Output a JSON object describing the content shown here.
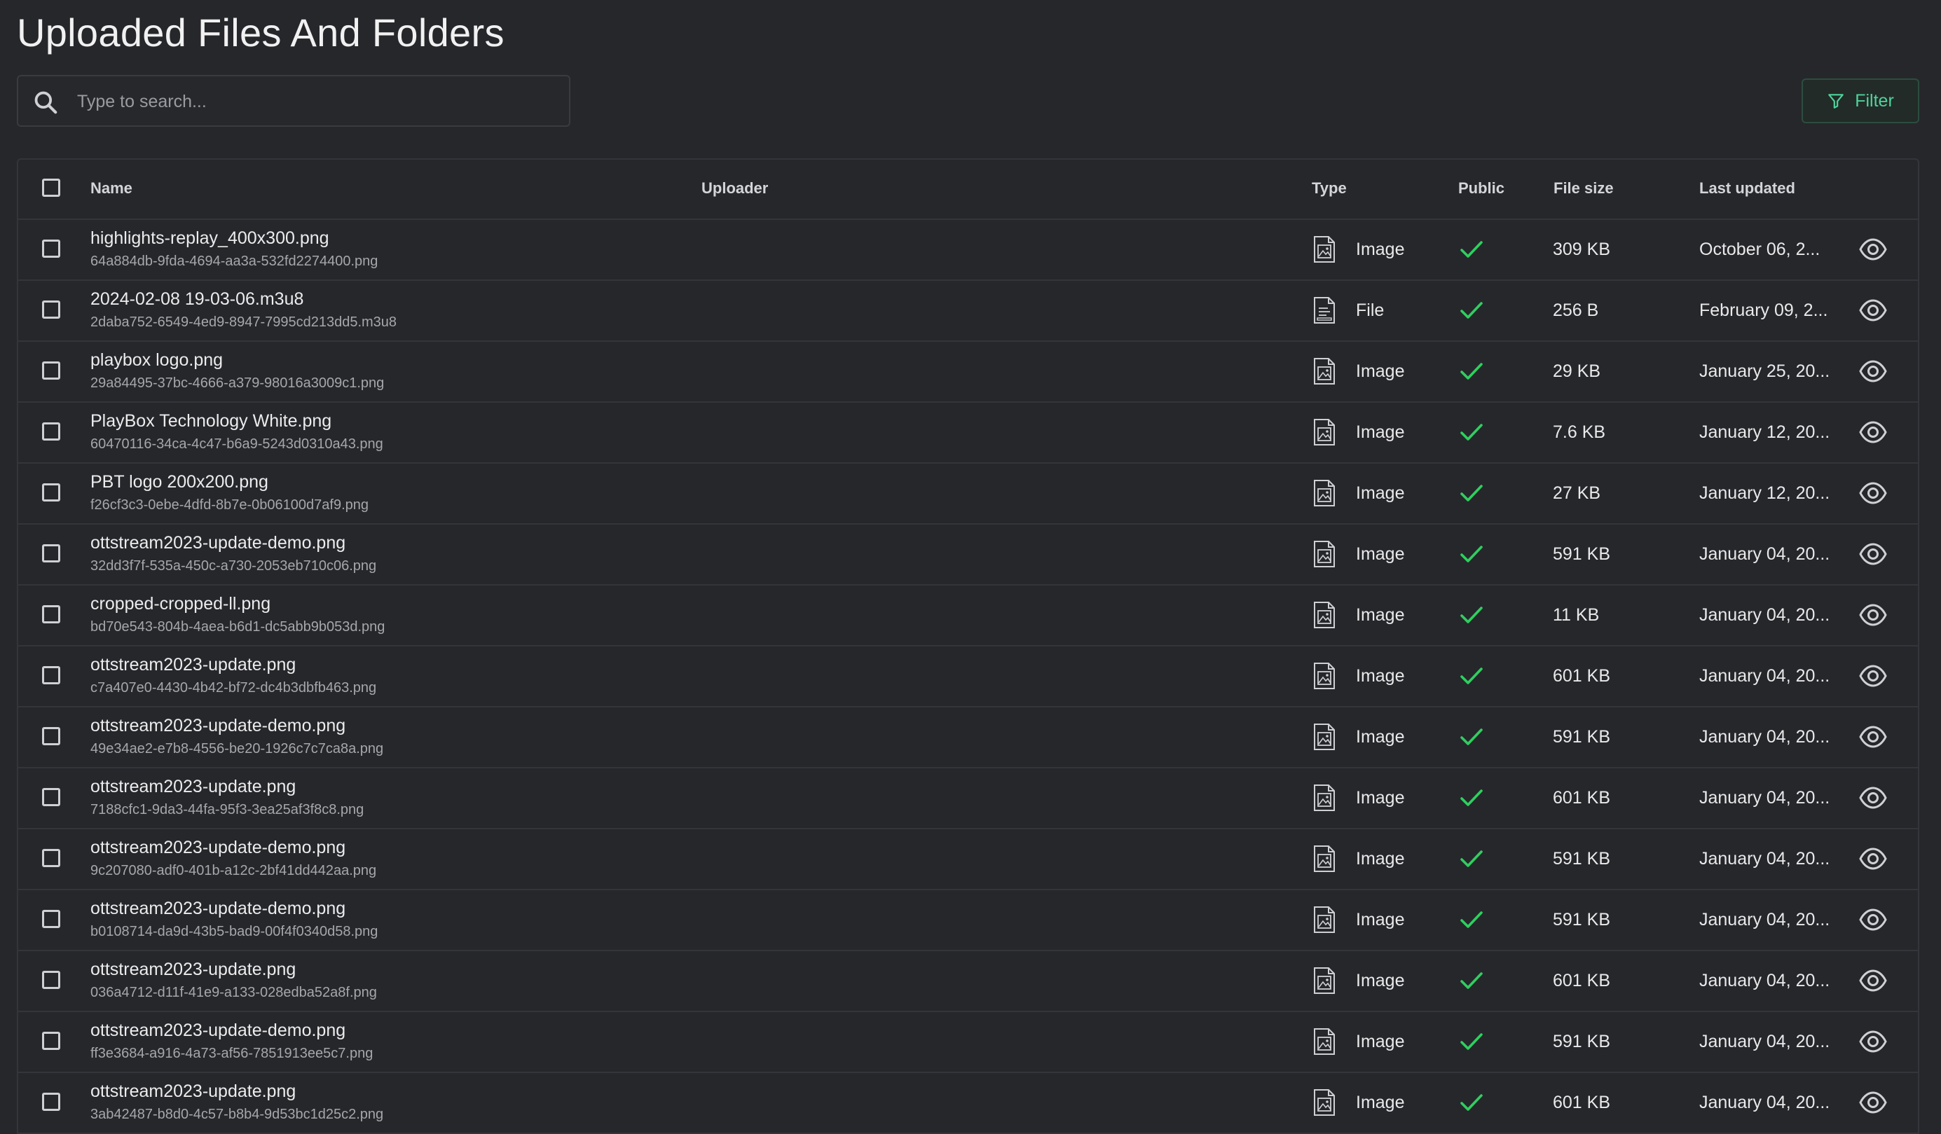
{
  "page": {
    "title": "Uploaded Files And Folders"
  },
  "search": {
    "placeholder": "Type to search...",
    "value": ""
  },
  "toolbar": {
    "filter_label": "Filter"
  },
  "colors": {
    "background": "#26272b",
    "accent": "#4fd39b",
    "check": "#2fcf5f",
    "border": "#34353a"
  },
  "table": {
    "columns": {
      "name": "Name",
      "uploader": "Uploader",
      "type": "Type",
      "public": "Public",
      "size": "File size",
      "updated": "Last updated"
    },
    "rows": [
      {
        "name": "highlights-replay_400x300.png",
        "id": "64a884db-9fda-4694-aa3a-532fd2274400.png",
        "type": "Image",
        "icon": "image-file-icon",
        "public": true,
        "size": "309 KB",
        "updated": "October 06, 2..."
      },
      {
        "name": "2024-02-08 19-03-06.m3u8",
        "id": "2daba752-6549-4ed9-8947-7995cd213dd5.m3u8",
        "type": "File",
        "icon": "document-file-icon",
        "public": true,
        "size": "256 B",
        "updated": "February 09, 2..."
      },
      {
        "name": "playbox logo.png",
        "id": "29a84495-37bc-4666-a379-98016a3009c1.png",
        "type": "Image",
        "icon": "image-file-icon",
        "public": true,
        "size": "29 KB",
        "updated": "January 25, 20..."
      },
      {
        "name": "PlayBox Technology White.png",
        "id": "60470116-34ca-4c47-b6a9-5243d0310a43.png",
        "type": "Image",
        "icon": "image-file-icon",
        "public": true,
        "size": "7.6 KB",
        "updated": "January 12, 20..."
      },
      {
        "name": "PBT logo 200x200.png",
        "id": "f26cf3c3-0ebe-4dfd-8b7e-0b06100d7af9.png",
        "type": "Image",
        "icon": "image-file-icon",
        "public": true,
        "size": "27 KB",
        "updated": "January 12, 20..."
      },
      {
        "name": "ottstream2023-update-demo.png",
        "id": "32dd3f7f-535a-450c-a730-2053eb710c06.png",
        "type": "Image",
        "icon": "image-file-icon",
        "public": true,
        "size": "591 KB",
        "updated": "January 04, 20..."
      },
      {
        "name": "cropped-cropped-ll.png",
        "id": "bd70e543-804b-4aea-b6d1-dc5abb9b053d.png",
        "type": "Image",
        "icon": "image-file-icon",
        "public": true,
        "size": "11 KB",
        "updated": "January 04, 20..."
      },
      {
        "name": "ottstream2023-update.png",
        "id": "c7a407e0-4430-4b42-bf72-dc4b3dbfb463.png",
        "type": "Image",
        "icon": "image-file-icon",
        "public": true,
        "size": "601 KB",
        "updated": "January 04, 20..."
      },
      {
        "name": "ottstream2023-update-demo.png",
        "id": "49e34ae2-e7b8-4556-be20-1926c7c7ca8a.png",
        "type": "Image",
        "icon": "image-file-icon",
        "public": true,
        "size": "591 KB",
        "updated": "January 04, 20..."
      },
      {
        "name": "ottstream2023-update.png",
        "id": "7188cfc1-9da3-44fa-95f3-3ea25af3f8c8.png",
        "type": "Image",
        "icon": "image-file-icon",
        "public": true,
        "size": "601 KB",
        "updated": "January 04, 20..."
      },
      {
        "name": "ottstream2023-update-demo.png",
        "id": "9c207080-adf0-401b-a12c-2bf41dd442aa.png",
        "type": "Image",
        "icon": "image-file-icon",
        "public": true,
        "size": "591 KB",
        "updated": "January 04, 20..."
      },
      {
        "name": "ottstream2023-update-demo.png",
        "id": "b0108714-da9d-43b5-bad9-00f4f0340d58.png",
        "type": "Image",
        "icon": "image-file-icon",
        "public": true,
        "size": "591 KB",
        "updated": "January 04, 20..."
      },
      {
        "name": "ottstream2023-update.png",
        "id": "036a4712-d11f-41e9-a133-028edba52a8f.png",
        "type": "Image",
        "icon": "image-file-icon",
        "public": true,
        "size": "601 KB",
        "updated": "January 04, 20..."
      },
      {
        "name": "ottstream2023-update-demo.png",
        "id": "ff3e3684-a916-4a73-af56-7851913ee5c7.png",
        "type": "Image",
        "icon": "image-file-icon",
        "public": true,
        "size": "591 KB",
        "updated": "January 04, 20..."
      },
      {
        "name": "ottstream2023-update.png",
        "id": "3ab42487-b8d0-4c57-b8b4-9d53bc1d25c2.png",
        "type": "Image",
        "icon": "image-file-icon",
        "public": true,
        "size": "601 KB",
        "updated": "January 04, 20..."
      }
    ]
  }
}
